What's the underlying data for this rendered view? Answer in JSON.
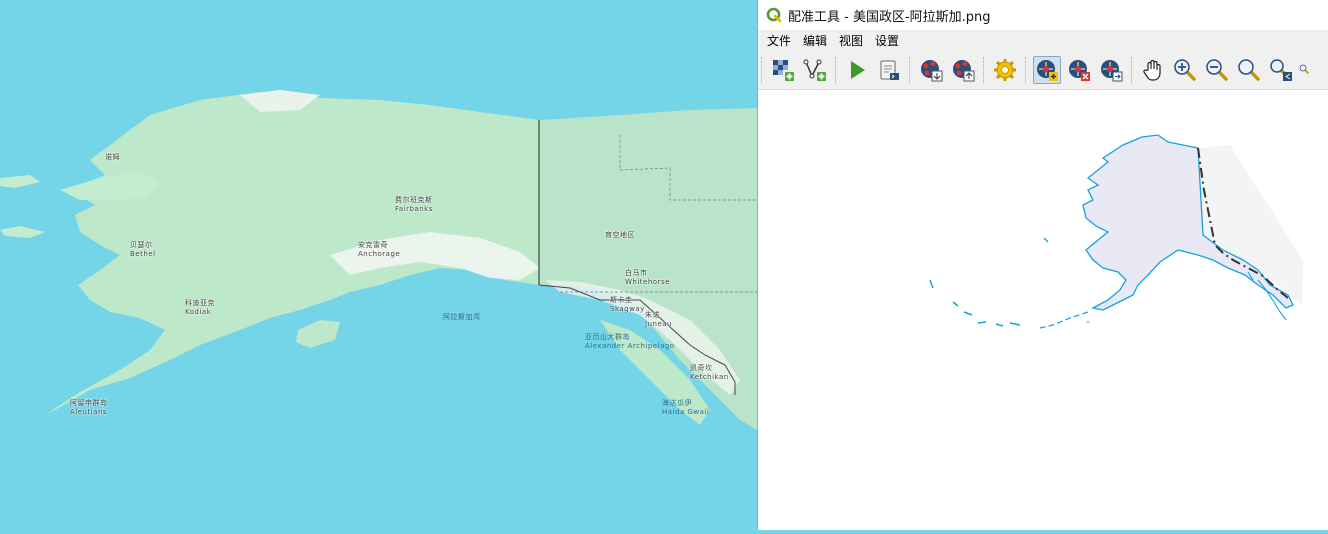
{
  "map": {
    "labels": [
      {
        "id": "l1",
        "text": "诺姆"
      },
      {
        "id": "l2",
        "text": "安克雷奇\nAnchorage"
      },
      {
        "id": "l3",
        "text": "费尔班克斯\nFairbanks"
      },
      {
        "id": "l4",
        "text": "阿拉斯加湾"
      },
      {
        "id": "l5",
        "text": "亚历山大群岛\nAlexander Archipelago"
      },
      {
        "id": "l6",
        "text": "白马市\nWhitehorse"
      },
      {
        "id": "l7",
        "text": "朱诺\nJuneau"
      },
      {
        "id": "l8",
        "text": "凯奇坎\nKetchikan"
      },
      {
        "id": "l9",
        "text": "海达瓜伊\nHaida Gwaii"
      },
      {
        "id": "l10",
        "text": "科迪亚克\nKodiak"
      },
      {
        "id": "l11",
        "text": "阿留申群岛\nAleutians"
      },
      {
        "id": "l12",
        "text": "斯卡圭\nSkagway"
      },
      {
        "id": "l13",
        "text": "贝瑟尔\nBethel"
      },
      {
        "id": "l14",
        "text": "育空地区"
      }
    ]
  },
  "window": {
    "title": "配准工具 - 美国政区-阿拉斯加.png",
    "menu": [
      "文件",
      "编辑",
      "视图",
      "设置"
    ],
    "toolbar": [
      {
        "name": "open-raster-button",
        "active": false
      },
      {
        "name": "open-vector-button",
        "active": false
      },
      {
        "name": "start-georeferencing-button",
        "active": false
      },
      {
        "name": "generate-script-button",
        "active": false
      },
      {
        "name": "load-gcp-button",
        "active": false
      },
      {
        "name": "save-gcp-button",
        "active": false
      },
      {
        "name": "transformation-settings-button",
        "active": false
      },
      {
        "name": "add-point-button",
        "active": true
      },
      {
        "name": "delete-point-button",
        "active": false
      },
      {
        "name": "move-gcp-button",
        "active": false
      },
      {
        "name": "pan-button",
        "active": false
      },
      {
        "name": "zoom-in-button",
        "active": false
      },
      {
        "name": "zoom-out-button",
        "active": false
      },
      {
        "name": "zoom-to-layer-button",
        "active": false
      },
      {
        "name": "zoom-last-button",
        "active": false
      }
    ]
  }
}
